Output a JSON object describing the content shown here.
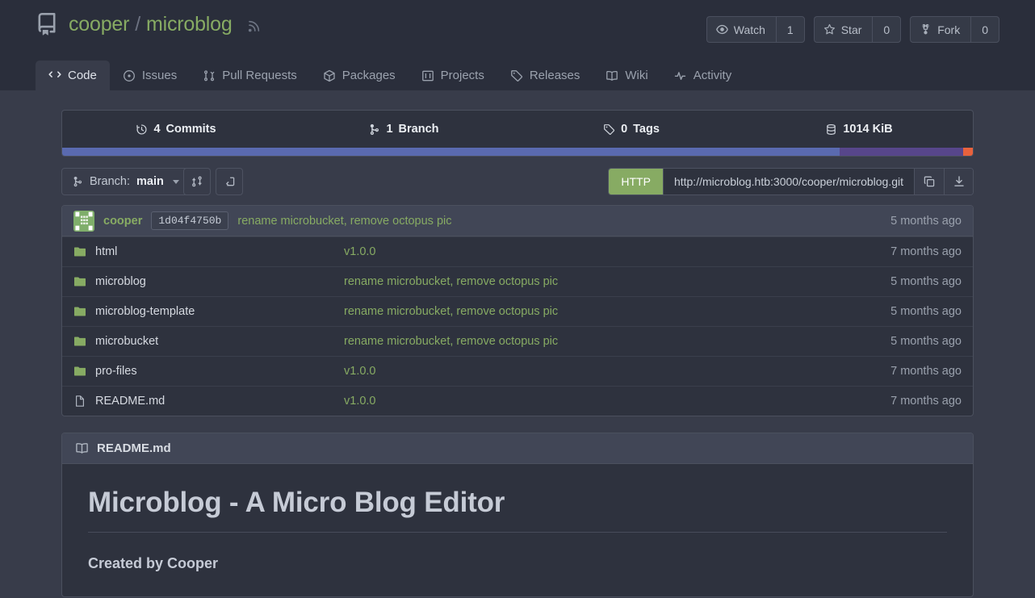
{
  "header": {
    "repo_icon": "repo-icon",
    "owner": "cooper",
    "separator": "/",
    "name": "microblog",
    "rss_icon": "rss-icon",
    "actions": [
      {
        "icon": "eye-icon",
        "label": "Watch",
        "count": "1"
      },
      {
        "icon": "star-icon",
        "label": "Star",
        "count": "0"
      },
      {
        "icon": "fork-icon",
        "label": "Fork",
        "count": "0"
      }
    ],
    "tabs": [
      {
        "icon": "code-icon",
        "label": "Code",
        "active": true
      },
      {
        "icon": "issues-icon",
        "label": "Issues",
        "active": false
      },
      {
        "icon": "pull-request-icon",
        "label": "Pull Requests",
        "active": false
      },
      {
        "icon": "package-icon",
        "label": "Packages",
        "active": false
      },
      {
        "icon": "projects-icon",
        "label": "Projects",
        "active": false
      },
      {
        "icon": "tag-icon",
        "label": "Releases",
        "active": false
      },
      {
        "icon": "book-icon",
        "label": "Wiki",
        "active": false
      },
      {
        "icon": "activity-icon",
        "label": "Activity",
        "active": false
      }
    ]
  },
  "stats": [
    {
      "icon": "clock-icon",
      "count": "4",
      "label": "Commits"
    },
    {
      "icon": "branch-icon",
      "count": "1",
      "label": "Branch"
    },
    {
      "icon": "tag-icon",
      "count": "0",
      "label": "Tags"
    },
    {
      "icon": "database-icon",
      "count": "1014 KiB",
      "label": ""
    }
  ],
  "languages": [
    {
      "name": "blue-segment",
      "color": "#5a6ab0",
      "percent": 85.4
    },
    {
      "name": "purple-segment",
      "color": "#57468b",
      "percent": 13.5
    },
    {
      "name": "orange-segment",
      "color": "#e8623d",
      "percent": 1.1
    }
  ],
  "clone": {
    "branch_prefix": "Branch:",
    "branch_name": "main",
    "branch_icon": "branch-icon",
    "compare_icon": "compare-icon",
    "fork_pr_icon": "new-pull-request-icon",
    "protocol": "HTTP",
    "url": "http://microblog.htb:3000/cooper/microblog.git",
    "copy_icon": "copy-icon",
    "download_icon": "download-icon"
  },
  "latest_commit": {
    "avatar": "cooper-avatar",
    "author": "cooper",
    "sha": "1d04f4750b",
    "message": "rename microbucket, remove octopus pic",
    "age": "5 months ago"
  },
  "files": [
    {
      "icon": "folder-icon",
      "type": "folder",
      "name": "html",
      "message": "v1.0.0",
      "age": "7 months ago"
    },
    {
      "icon": "folder-icon",
      "type": "folder",
      "name": "microblog",
      "message": "rename microbucket, remove octopus pic",
      "age": "5 months ago"
    },
    {
      "icon": "folder-icon",
      "type": "folder",
      "name": "microblog-template",
      "message": "rename microbucket, remove octopus pic",
      "age": "5 months ago"
    },
    {
      "icon": "folder-icon",
      "type": "folder",
      "name": "microbucket",
      "message": "rename microbucket, remove octopus pic",
      "age": "5 months ago"
    },
    {
      "icon": "folder-icon",
      "type": "folder",
      "name": "pro-files",
      "message": "v1.0.0",
      "age": "7 months ago"
    },
    {
      "icon": "file-icon",
      "type": "file",
      "name": "README.md",
      "message": "v1.0.0",
      "age": "7 months ago"
    }
  ],
  "readme": {
    "icon": "book-icon",
    "title": "README.md",
    "heading": "Microblog - A Micro Blog Editor",
    "subheading": "Created by Cooper"
  },
  "colors": {
    "accent_green": "#87ab63",
    "header_bg": "#2a2e3b",
    "body_bg": "#383c4a",
    "panel_bg": "#2e323e",
    "panel_head_bg": "#414656",
    "border": "#4b505e",
    "text": "#d6dae1",
    "muted": "#9aa1ad"
  }
}
